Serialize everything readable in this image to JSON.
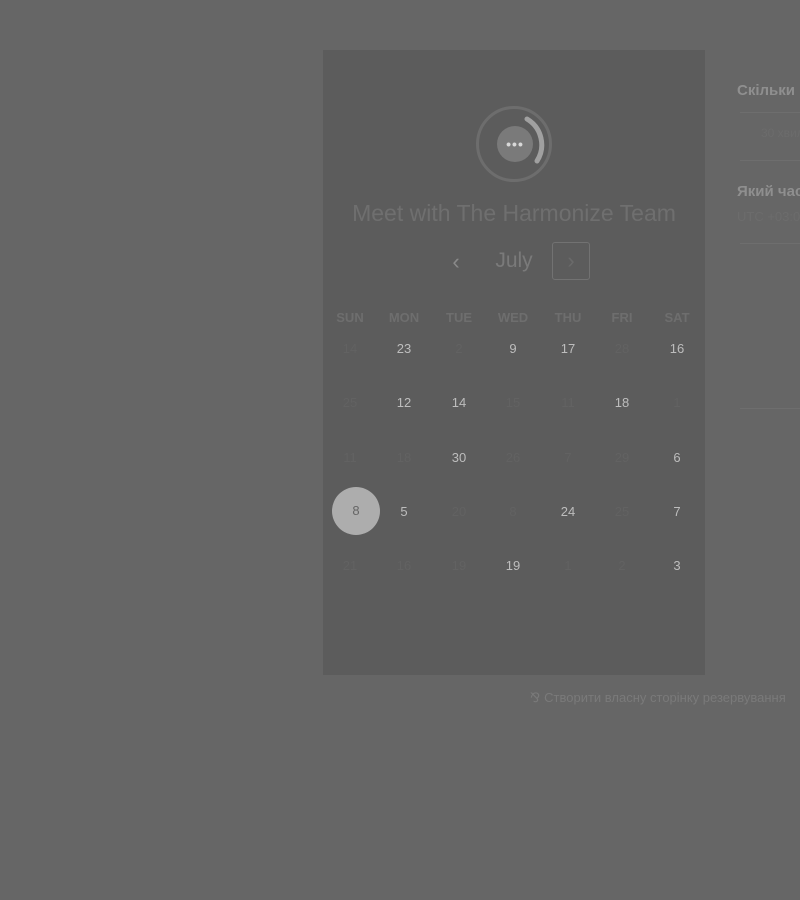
{
  "brand": {
    "logo_symbol": "•••",
    "logo_icon": "chat-bubble-icon"
  },
  "meeting": {
    "title": "Meet with The Harmonize Team"
  },
  "calendar": {
    "prev_symbol": "‹",
    "next_symbol": "›",
    "month": "July",
    "weekdays": [
      "SUN",
      "MON",
      "TUE",
      "WED",
      "THU",
      "FRI",
      "SAT"
    ],
    "rows": [
      [
        {
          "d": "14",
          "a": false
        },
        {
          "d": "23",
          "a": true
        },
        {
          "d": "2",
          "a": false
        },
        {
          "d": "9",
          "a": true
        },
        {
          "d": "17",
          "a": true
        },
        {
          "d": "28",
          "a": false
        },
        {
          "d": "16",
          "a": true
        }
      ],
      [
        {
          "d": "25",
          "a": false
        },
        {
          "d": "12",
          "a": true
        },
        {
          "d": "14",
          "a": true
        },
        {
          "d": "15",
          "a": false
        },
        {
          "d": "11",
          "a": false
        },
        {
          "d": "18",
          "a": true
        },
        {
          "d": "1",
          "a": false
        }
      ],
      [
        {
          "d": "11",
          "a": false
        },
        {
          "d": "18",
          "a": false
        },
        {
          "d": "30",
          "a": true
        },
        {
          "d": "26",
          "a": false
        },
        {
          "d": "7",
          "a": false
        },
        {
          "d": "29",
          "a": false
        },
        {
          "d": "6",
          "a": true
        }
      ],
      [
        {
          "d": "8",
          "a": true,
          "selected": true
        },
        {
          "d": "5",
          "a": true
        },
        {
          "d": "20",
          "a": false
        },
        {
          "d": "8",
          "a": false
        },
        {
          "d": "24",
          "a": true
        },
        {
          "d": "25",
          "a": false
        },
        {
          "d": "7",
          "a": true
        }
      ],
      [
        {
          "d": "21",
          "a": false
        },
        {
          "d": "16",
          "a": false
        },
        {
          "d": "19",
          "a": false
        },
        {
          "d": "19",
          "a": true
        },
        {
          "d": "1",
          "a": false
        },
        {
          "d": "2",
          "a": false
        },
        {
          "d": "3",
          "a": true
        }
      ]
    ],
    "selected_day": "8"
  },
  "side": {
    "question_duration": "Скільки",
    "duration_value": "30 хвил",
    "question_time": "Який час",
    "timezone_value": "UTC +03:0"
  },
  "footer": {
    "icon": "hubspot-sprocket-icon",
    "symbol": "⅋",
    "text": "Створити власну сторінку резервування"
  },
  "colors": {
    "overlay": "#666666",
    "card": "#5c5c5c",
    "selected_day": "#adadad"
  }
}
